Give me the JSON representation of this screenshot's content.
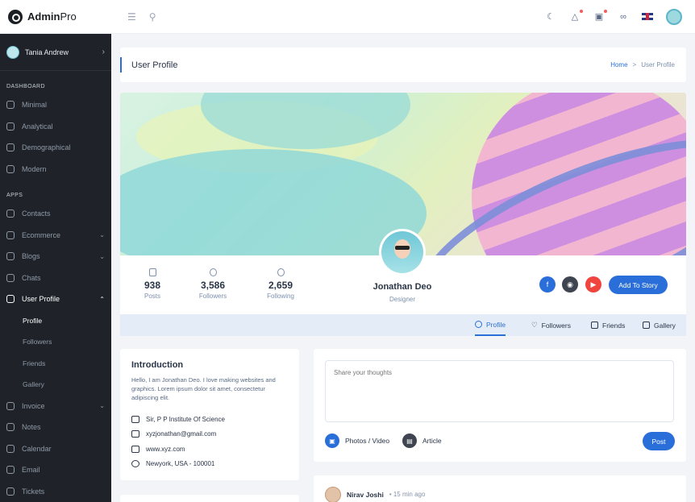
{
  "brand": {
    "name_bold": "Admin",
    "name_light": "Pro"
  },
  "header": {
    "menu_icon": "menu-icon",
    "search_icon": "search-icon"
  },
  "sidebar": {
    "user": "Tania Andrew",
    "section_dashboard": "DASHBOARD",
    "dashboard_items": [
      "Minimal",
      "Analytical",
      "Demographical",
      "Modern"
    ],
    "section_apps": "APPS",
    "apps_items": [
      "Contacts",
      "Ecommerce",
      "Blogs",
      "Chats",
      "User Profile"
    ],
    "profile_sub": [
      "Profile",
      "Followers",
      "Friends",
      "Gallery"
    ],
    "more_items": [
      "Invoice",
      "Notes",
      "Calendar",
      "Email",
      "Tickets"
    ]
  },
  "page": {
    "title": "User Profile",
    "crumb_home": "Home",
    "crumb_sep": ">",
    "crumb_current": "User Profile"
  },
  "profile": {
    "stats": [
      {
        "value": "938",
        "label": "Posts"
      },
      {
        "value": "3,586",
        "label": "Followers"
      },
      {
        "value": "2,659",
        "label": "Following"
      }
    ],
    "name": "Jonathan Deo",
    "role": "Designer",
    "add_story": "Add To Story",
    "social_colors": {
      "facebook": "#2a6ed9",
      "dribbble": "#3e4550",
      "youtube": "#f0443e"
    }
  },
  "tabs": [
    "Profile",
    "Followers",
    "Friends",
    "Gallery"
  ],
  "intro": {
    "title": "Introduction",
    "text": "Hello, I am Jonathan Deo. I love making websites and graphics. Lorem ipsum dolor sit amet, consectetur adipiscing elit.",
    "rows": [
      "Sir, P P Institute Of Science",
      "xyzjonathan@gmail.com",
      "www.xyz.com",
      "Newyork, USA - 100001"
    ]
  },
  "post": {
    "placeholder": "Share your thoughts",
    "photos": "Photos / Video",
    "article": "Article",
    "submit": "Post"
  },
  "feed": {
    "name": "Nirav Joshi",
    "time": "15 min ago"
  }
}
